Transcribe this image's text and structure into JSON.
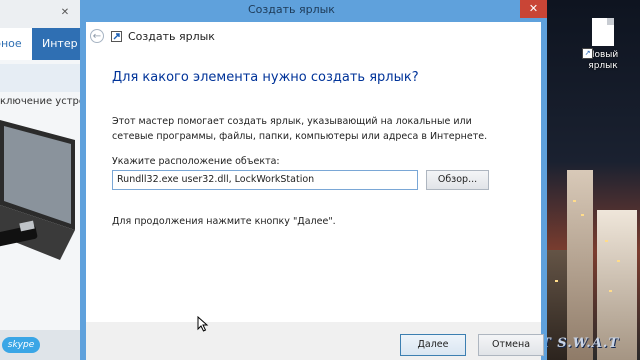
{
  "background_browser": {
    "nav_items": [
      "рное",
      "Интер"
    ],
    "banner_text": "ключение устро",
    "footer_logo": "skype"
  },
  "desktop": {
    "icon_label_line1": "Новый",
    "icon_label_line2": "ярлык",
    "watermark": "IT S.W.A.T"
  },
  "dialog": {
    "title": "Создать ярлык",
    "header_title": "Создать ярлык",
    "heading": "Для какого элемента нужно создать ярлык?",
    "description": "Этот мастер помогает создать ярлык, указывающий на локальные или сетевые программы, файлы, папки, компьютеры или адреса в Интернете.",
    "location_label": "Укажите расположение объекта:",
    "location_value": "Rundll32.exe user32.dll, LockWorkStation",
    "browse_label": "Обзор...",
    "hint": "Для продолжения нажмите кнопку \"Далее\".",
    "next_label": "Далее",
    "cancel_label": "Отмена",
    "close_glyph": "✕",
    "back_glyph": "←"
  },
  "colors": {
    "window_frame": "#5fa1dc",
    "heading": "#003399",
    "close_button": "#c94536"
  },
  "icons": [
    "back-arrow-icon",
    "shortcut-wizard-icon",
    "close-icon",
    "shortcut-file-icon",
    "mouse-cursor-icon"
  ]
}
